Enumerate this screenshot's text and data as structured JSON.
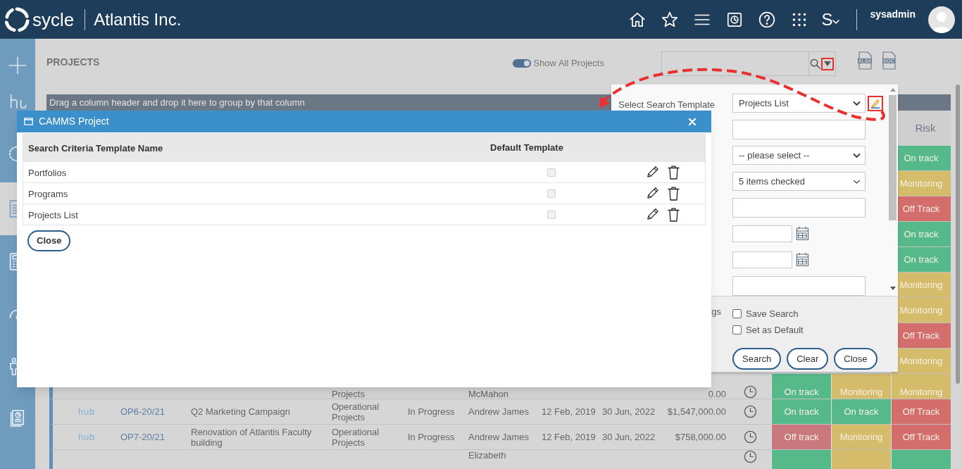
{
  "header": {
    "brand": "sycle",
    "company": "Atlantis Inc.",
    "user_menu": "S",
    "username": "sysadmin"
  },
  "sidebar": [
    {
      "kind": "add",
      "selected": false
    },
    {
      "kind": "hub",
      "selected": false
    },
    {
      "kind": "cycle",
      "selected": false
    },
    {
      "kind": "document",
      "selected": true
    },
    {
      "kind": "calculator",
      "selected": false
    },
    {
      "kind": "gauge",
      "selected": false
    },
    {
      "kind": "person",
      "selected": false
    },
    {
      "kind": "report",
      "selected": false
    }
  ],
  "toolbar": {
    "title": "PROJECTS",
    "toggle_label": "Show All Projects",
    "toggle_on": true,
    "exports": [
      "XLSX",
      "DOC"
    ]
  },
  "grid": {
    "group_hint": "Drag a column header and drop it here to group by that column",
    "risk_header": "Risk",
    "rows": [
      {
        "kind": "risk_only",
        "statuses": [
          {
            "label": "On track",
            "color": "#55b98a"
          }
        ]
      },
      {
        "kind": "risk_only",
        "statuses": [
          {
            "label": "Monitoring",
            "color": "#d5bc6b"
          }
        ]
      },
      {
        "kind": "risk_only",
        "statuses": [
          {
            "label": "Off Track",
            "color": "#d36e6c"
          }
        ]
      },
      {
        "kind": "risk_only",
        "statuses": [
          {
            "label": "On track",
            "color": "#55b98a"
          }
        ]
      },
      {
        "kind": "risk_only",
        "statuses": [
          {
            "label": "On track",
            "color": "#55b98a"
          }
        ]
      },
      {
        "kind": "risk_only",
        "statuses": [
          {
            "label": "Monitoring",
            "color": "#d5bc6b"
          }
        ]
      },
      {
        "kind": "risk_only",
        "statuses": [
          {
            "label": "Monitoring",
            "color": "#d5bc6b"
          }
        ]
      },
      {
        "kind": "risk_only",
        "statuses": [
          {
            "label": "Off Track",
            "color": "#d36e6c"
          }
        ]
      },
      {
        "kind": "risk_only",
        "statuses": [
          {
            "label": "Monitoring",
            "color": "#d5bc6b"
          }
        ]
      },
      {
        "kind": "tail",
        "type": "Projects",
        "manager": "McMahon",
        "budget": "0.00",
        "statuses": [
          {
            "label": "On track",
            "color": "#55b98a"
          },
          {
            "label": "Monitoring",
            "color": "#d5bc6b"
          },
          {
            "label": "Monitoring",
            "color": "#d5bc6b"
          }
        ]
      },
      {
        "kind": "full",
        "logo": "hub",
        "id": "OP6-20/21",
        "name": "Q2 Marketing Campaign",
        "type": "Operational Projects",
        "status": "In Progress",
        "manager": "Andrew James",
        "start": "12 Feb, 2019",
        "end": "30 Jun, 2022",
        "budget": "$1,547,000.00",
        "statuses": [
          {
            "label": "On track",
            "color": "#55b98a"
          },
          {
            "label": "On track",
            "color": "#55b98a"
          },
          {
            "label": "Off Track",
            "color": "#d36e6c"
          }
        ]
      },
      {
        "kind": "full",
        "logo": "hub",
        "id": "OP7-20/21",
        "name": "Renovation of Atlantis Faculty building",
        "type": "Operational Projects",
        "status": "In Progress",
        "manager": "Andrew James",
        "start": "12 Feb, 2019",
        "end": "30 Jun, 2022",
        "budget": "$758,000.00",
        "statuses": [
          {
            "label": "Off track",
            "color": "#c9797e"
          },
          {
            "label": "Monitoring",
            "color": "#d5bc6b"
          },
          {
            "label": "Off Track",
            "color": "#d36e6c"
          }
        ]
      },
      {
        "kind": "head",
        "manager": "Elizabeth",
        "statuses": [
          {
            "color": "#55b98a"
          },
          {
            "color": "#d5bc6b"
          },
          {
            "color": "#55b98a"
          }
        ]
      }
    ]
  },
  "search_panel": {
    "label": "Select Search Template",
    "fields": [
      {
        "kind": "select",
        "value": "Projects List"
      },
      {
        "kind": "input"
      },
      {
        "kind": "select",
        "value": "-- please select --"
      },
      {
        "kind": "multiselect",
        "value": "5 items checked"
      },
      {
        "kind": "input"
      },
      {
        "kind": "date"
      },
      {
        "kind": "date"
      },
      {
        "kind": "input"
      }
    ],
    "label_fragment": "gs",
    "options": [
      {
        "label": "Save Search",
        "checked": false
      },
      {
        "label": "Set as Default",
        "checked": false
      }
    ],
    "buttons": [
      "Search",
      "Clear",
      "Close"
    ]
  },
  "modal": {
    "title": "CAMMS Project",
    "columns": [
      "Search Criteria Template Name",
      "Default Template"
    ],
    "rows": [
      {
        "name": "Portfolios",
        "default": false
      },
      {
        "name": "Programs",
        "default": false
      },
      {
        "name": "Projects List",
        "default": false
      }
    ],
    "close": "Close"
  }
}
